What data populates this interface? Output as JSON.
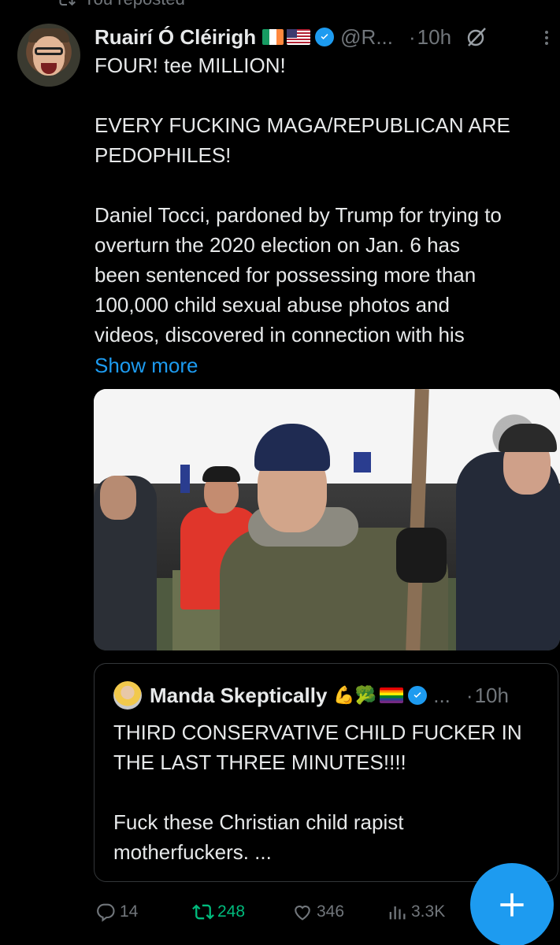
{
  "repost_banner": {
    "label": "You reposted"
  },
  "post": {
    "author_name": "Ruairí Ó Cléirigh",
    "author_handle": "@R...",
    "separator": "·",
    "time": "10h",
    "text_lines": [
      "FOUR! tee MILLION!",
      "",
      "EVERY FUCKING MAGA/REPUBLICAN ARE",
      "PEDOPHILES!",
      "",
      "Daniel Tocci, pardoned by Trump for trying to",
      "overturn the 2020 election on Jan. 6 has",
      "been sentenced for possessing more than",
      "100,000 child sexual abuse photos and",
      "videos, discovered in connection with his"
    ],
    "show_more": "Show more"
  },
  "quote": {
    "author_name": "Manda Skeptically",
    "emojis": "💪🥦",
    "handle": "...",
    "separator": "·",
    "time": "10h",
    "text_lines": [
      "THIRD CONSERVATIVE CHILD FUCKER IN",
      "THE LAST THREE MINUTES!!!!",
      "",
      "Fuck these Christian child rapist",
      "motherfuckers. ..."
    ]
  },
  "actions": {
    "replies": "14",
    "reposts": "248",
    "likes": "346",
    "views": "3.3K"
  },
  "colors": {
    "accent": "#1d9bf0",
    "repost_active": "#00ba7c",
    "muted": "#71767b",
    "background": "#000000"
  },
  "icons": {
    "repost": "repost-icon",
    "verified": "verified-badge-icon",
    "grok": "grok-icon",
    "more": "more-icon",
    "reply": "reply-icon",
    "like": "heart-icon",
    "views": "views-icon",
    "compose": "compose-plus-icon"
  }
}
